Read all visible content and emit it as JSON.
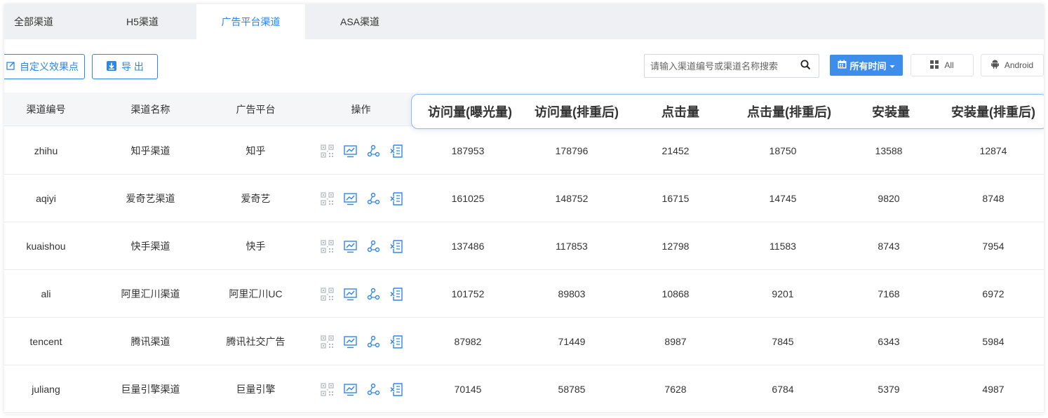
{
  "tabs": [
    {
      "label": "全部渠道",
      "active": false
    },
    {
      "label": "H5渠道",
      "active": false
    },
    {
      "label": "广告平台渠道",
      "active": true
    },
    {
      "label": "ASA渠道",
      "active": false
    }
  ],
  "toolbar": {
    "custom_effect_label": "自定义效果点",
    "export_label": "导 出",
    "search_placeholder": "请输入渠道编号或渠道名称搜索",
    "time_filter_label": "所有时间",
    "platform_all_label": "All",
    "platform_android_label": "Android"
  },
  "table": {
    "columns": [
      "渠道编号",
      "渠道名称",
      "广告平台",
      "操作",
      "访问量(曝光量)",
      "访问量(排重后)",
      "点击量",
      "点击量(排重后)",
      "安装量",
      "安装量(排重后)"
    ],
    "rows": [
      {
        "id": "zhihu",
        "name": "知乎渠道",
        "platform": "知乎",
        "visits": "187953",
        "visits_dedup": "178796",
        "clicks": "21452",
        "clicks_dedup": "18750",
        "installs": "13588",
        "installs_dedup": "12874"
      },
      {
        "id": "aqiyi",
        "name": "爱奇艺渠道",
        "platform": "爱奇艺",
        "visits": "161025",
        "visits_dedup": "148752",
        "clicks": "16715",
        "clicks_dedup": "14745",
        "installs": "9820",
        "installs_dedup": "8748"
      },
      {
        "id": "kuaishou",
        "name": "快手渠道",
        "platform": "快手",
        "visits": "137486",
        "visits_dedup": "117853",
        "clicks": "12798",
        "clicks_dedup": "11583",
        "installs": "8743",
        "installs_dedup": "7954"
      },
      {
        "id": "ali",
        "name": "阿里汇川渠道",
        "platform": "阿里汇川UC",
        "visits": "101752",
        "visits_dedup": "89803",
        "clicks": "10868",
        "clicks_dedup": "9201",
        "installs": "7168",
        "installs_dedup": "6972"
      },
      {
        "id": "tencent",
        "name": "腾讯渠道",
        "platform": "腾讯社交广告",
        "visits": "87982",
        "visits_dedup": "71449",
        "clicks": "8987",
        "clicks_dedup": "7845",
        "installs": "6343",
        "installs_dedup": "5984"
      },
      {
        "id": "juliang",
        "name": "巨量引擎渠道",
        "platform": "巨量引擎",
        "visits": "70145",
        "visits_dedup": "58785",
        "clicks": "7628",
        "clicks_dedup": "6784",
        "installs": "5379",
        "installs_dedup": "4987"
      }
    ],
    "row_actions": [
      "qrcode-icon",
      "chart-icon",
      "share-icon",
      "excel-export-icon"
    ]
  },
  "colors": {
    "accent": "#2f86e9",
    "qrcode_gray": "#b5b9c0"
  }
}
